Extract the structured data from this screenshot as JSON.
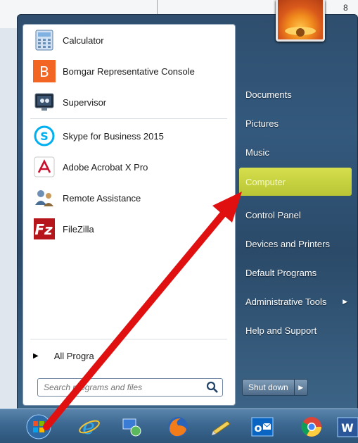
{
  "background": {
    "fragment_text": "8"
  },
  "start_menu": {
    "programs": [
      {
        "label": "Calculator",
        "icon": "calculator-icon"
      },
      {
        "label": "Bomgar Representative Console",
        "icon": "bomgar-icon"
      },
      {
        "label": "Supervisor",
        "icon": "supervisor-icon"
      },
      {
        "label": "Skype for Business 2015",
        "icon": "skype-icon"
      },
      {
        "label": "Adobe Acrobat X Pro",
        "icon": "acrobat-icon"
      },
      {
        "label": "Remote Assistance",
        "icon": "remote-assistance-icon"
      },
      {
        "label": "FileZilla",
        "icon": "filezilla-icon"
      }
    ],
    "all_programs_label": "All Progra",
    "search": {
      "placeholder": "Search programs and files",
      "value": ""
    },
    "right_items": [
      {
        "label": "Documents"
      },
      {
        "label": "Pictures"
      },
      {
        "label": "Music"
      },
      {
        "label": "Computer",
        "highlighted": true
      },
      {
        "label": "Control Panel"
      },
      {
        "label": "Devices and Printers"
      },
      {
        "label": "Default Programs"
      },
      {
        "label": "Administrative Tools",
        "has_submenu": true
      },
      {
        "label": "Help and Support"
      }
    ],
    "shutdown_label": "Shut down"
  },
  "taskbar": {
    "items": [
      "start-orb-icon",
      "internet-explorer-icon",
      "network-tool-icon",
      "firefox-icon",
      "pencil-icon",
      "outlook-icon",
      "chrome-icon",
      "word-icon"
    ],
    "outlook_text": "o",
    "word_text": "W"
  },
  "colors": {
    "highlight": "#c6d03e",
    "arrow": "#e01010",
    "taskbar": "#3c6891"
  }
}
